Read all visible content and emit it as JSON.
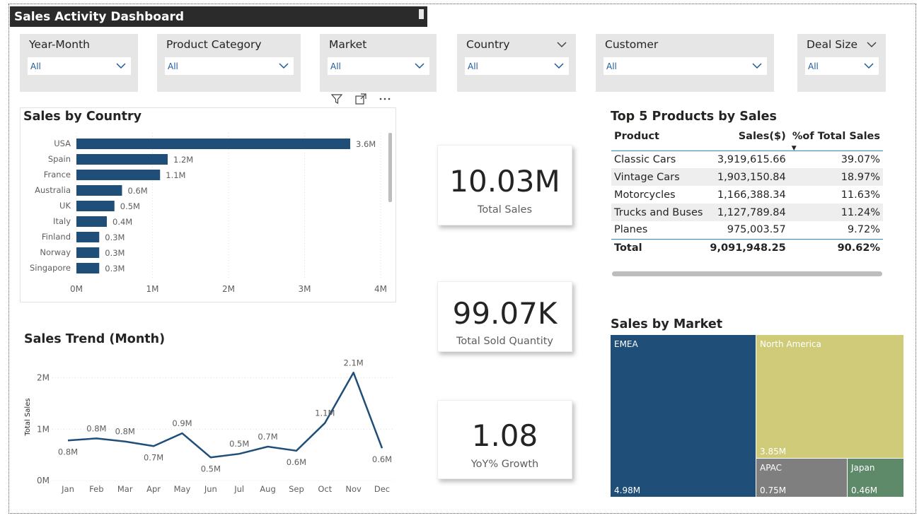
{
  "title": "Sales Activity Dashboard",
  "slicers": [
    {
      "label": "Year-Month",
      "value": "All"
    },
    {
      "label": "Product Category",
      "value": "All"
    },
    {
      "label": "Market",
      "value": "All"
    },
    {
      "label": "Country",
      "value": "All"
    },
    {
      "label": "Customer",
      "value": "All"
    },
    {
      "label": "Deal Size",
      "value": "All"
    }
  ],
  "visual_header_icons": [
    "filter-icon",
    "focus-mode-icon",
    "more-options-icon"
  ],
  "bar_chart": {
    "title": "Sales by Country",
    "chart_data": {
      "type": "bar",
      "orientation": "horizontal",
      "categories": [
        "USA",
        "Spain",
        "France",
        "Australia",
        "UK",
        "Italy",
        "Finland",
        "Norway",
        "Singapore"
      ],
      "values": [
        3.6,
        1.2,
        1.1,
        0.6,
        0.5,
        0.4,
        0.3,
        0.3,
        0.3
      ],
      "labels": [
        "3.6M",
        "1.2M",
        "1.1M",
        "0.6M",
        "0.5M",
        "0.4M",
        "0.3M",
        "0.3M",
        "0.3M"
      ],
      "xticks": [
        "0M",
        "1M",
        "2M",
        "3M",
        "4M"
      ],
      "xlim": [
        0,
        4
      ],
      "color": "#1f4e79",
      "grid": true
    }
  },
  "line_chart": {
    "title": "Sales Trend (Month)",
    "chart_data": {
      "type": "line",
      "categories": [
        "Jan",
        "Feb",
        "Mar",
        "Apr",
        "May",
        "Jun",
        "Jul",
        "Aug",
        "Sep",
        "Oct",
        "Nov",
        "Dec"
      ],
      "values": [
        0.78,
        0.82,
        0.76,
        0.67,
        0.92,
        0.45,
        0.52,
        0.66,
        0.58,
        1.12,
        2.1,
        0.63
      ],
      "labels": [
        "0.8M",
        "0.8M",
        "0.8M",
        "0.7M",
        "0.9M",
        "0.5M",
        "0.5M",
        "0.7M",
        "0.6M",
        "1.1M",
        "2.1M",
        "0.6M"
      ],
      "ylabel": "Total Sales",
      "yticks": [
        "0M",
        "1M",
        "2M"
      ],
      "ylim": [
        0,
        2.2
      ],
      "color": "#1f4e79",
      "grid": true
    }
  },
  "cards": [
    {
      "value": "10.03M",
      "caption": "Total Sales"
    },
    {
      "value": "99.07K",
      "caption": "Total Sold Quantity"
    },
    {
      "value": "1.08",
      "caption": "YoY% Growth"
    }
  ],
  "top5": {
    "title": "Top 5 Products by Sales",
    "columns": [
      "Product",
      "Sales($)",
      "%of Total Sales"
    ],
    "rows": [
      [
        "Classic Cars",
        "3,919,615.66",
        "39.07%"
      ],
      [
        "Vintage Cars",
        "1,903,150.84",
        "18.97%"
      ],
      [
        "Motorcycles",
        "1,166,388.34",
        "11.63%"
      ],
      [
        "Trucks and Buses",
        "1,127,789.84",
        "11.24%"
      ],
      [
        "Planes",
        "975,003.57",
        "9.72%"
      ]
    ],
    "total": [
      "Total",
      "9,091,948.25",
      "90.62%"
    ]
  },
  "treemap": {
    "title": "Sales by Market",
    "items": [
      {
        "name": "EMEA",
        "value": "4.98M",
        "color": "#1f4e79"
      },
      {
        "name": "North America",
        "value": "3.85M",
        "color": "#cfcb79"
      },
      {
        "name": "APAC",
        "value": "0.75M",
        "color": "#7f7f7f"
      },
      {
        "name": "Japan",
        "value": "0.46M",
        "color": "#5f8a6a"
      }
    ]
  }
}
